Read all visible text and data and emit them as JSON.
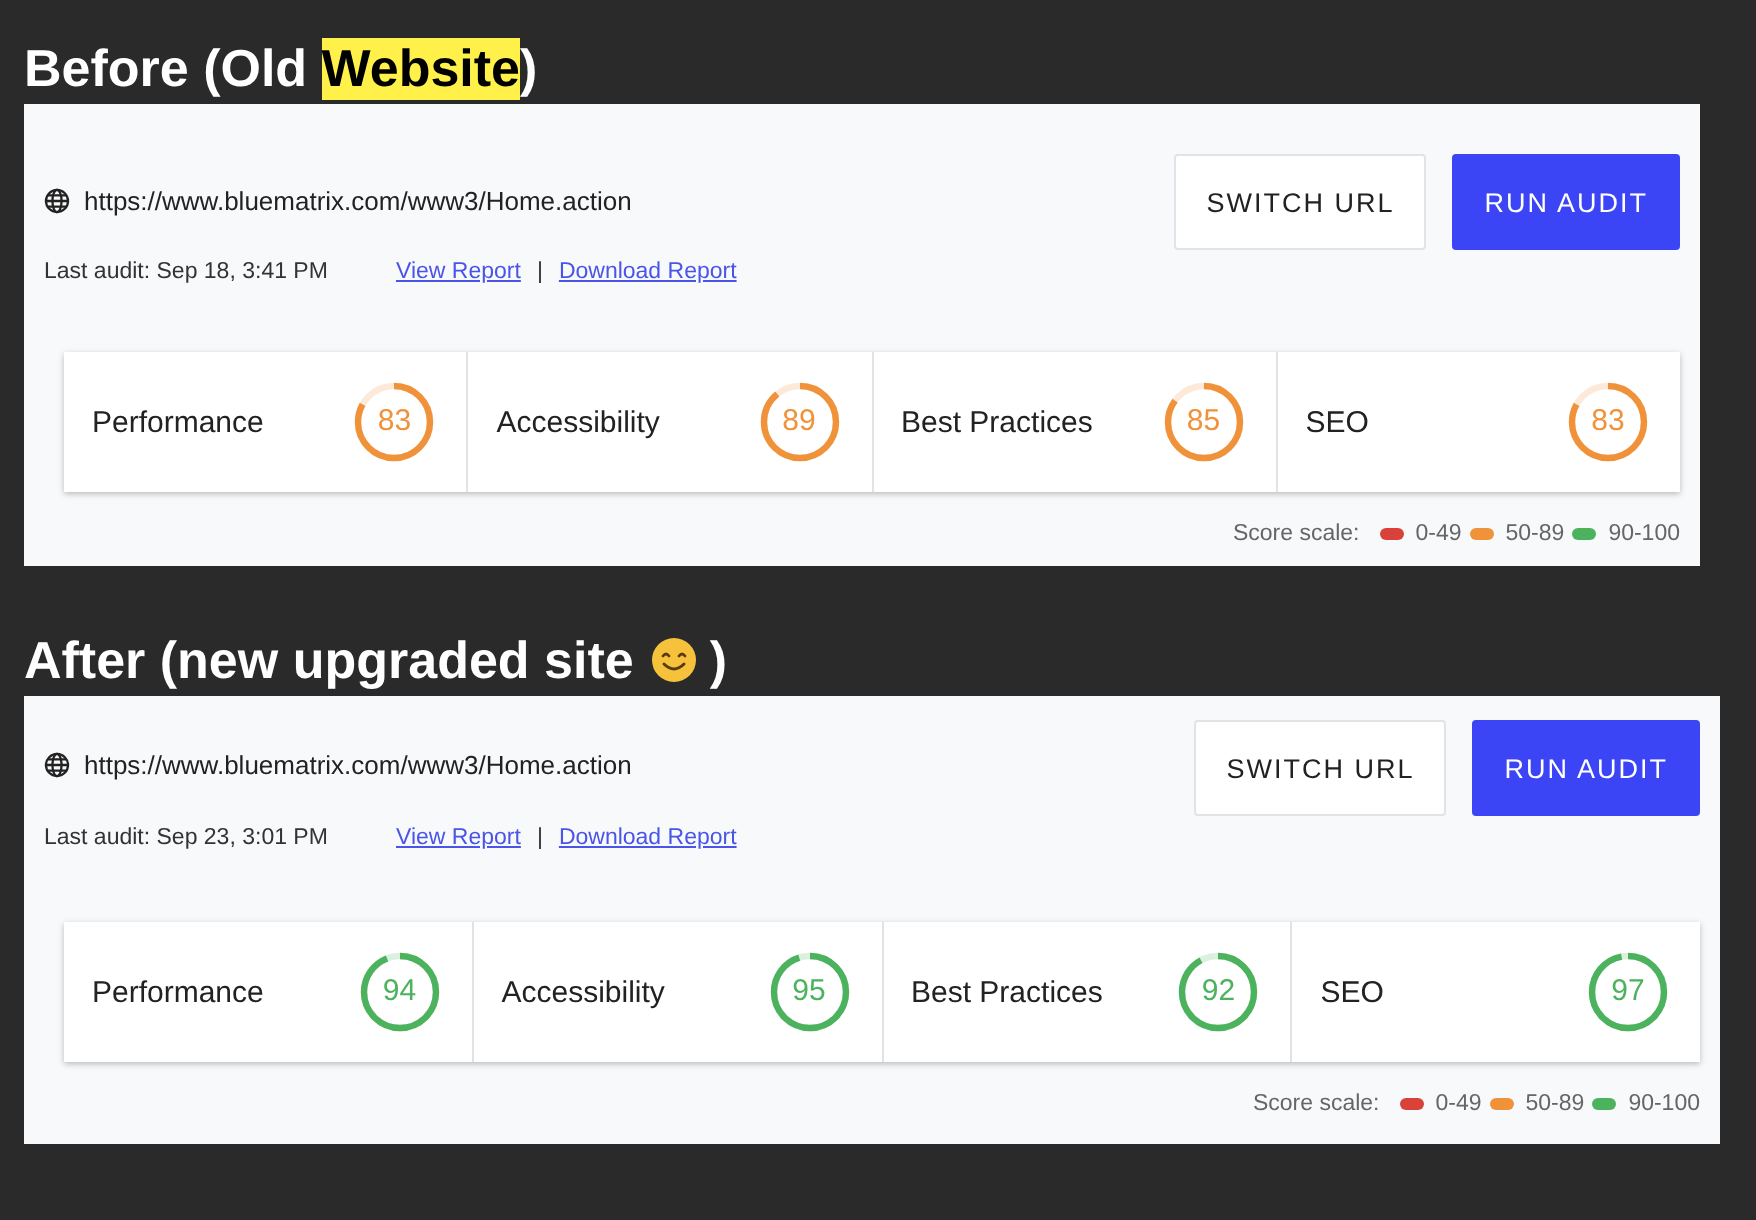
{
  "sections": [
    {
      "heading": [
        {
          "kind": "text",
          "text": "Before (Old "
        },
        {
          "kind": "highlight",
          "text": "Website"
        },
        {
          "kind": "text",
          "text": ")"
        }
      ],
      "url": "https://www.bluematrix.com/www3/Home.action",
      "last_audit": "Last audit: Sep 18, 3:41 PM",
      "links": [
        "View Report",
        "Download Report"
      ],
      "separator": "|",
      "buttons": [
        {
          "label": "SWITCH URL",
          "kind": "secondary"
        },
        {
          "label": "RUN AUDIT",
          "kind": "primary"
        }
      ],
      "scores": [
        {
          "label": "Performance",
          "score": "83",
          "color": "#f0923a"
        },
        {
          "label": "Accessibility",
          "score": "89",
          "color": "#f0923a"
        },
        {
          "label": "Best Practices",
          "score": "85",
          "color": "#f0923a"
        },
        {
          "label": "SEO",
          "score": "83",
          "color": "#f0923a"
        }
      ],
      "legend": {
        "title": "Score scale:",
        "items": [
          {
            "label": "0-49",
            "color": "#d9423a"
          },
          {
            "label": "50-89",
            "color": "#f0923a"
          },
          {
            "label": "90-100",
            "color": "#4cb25e"
          }
        ]
      }
    },
    {
      "heading": [
        {
          "kind": "text",
          "text": "After (new upgraded site"
        },
        {
          "kind": "smiley"
        },
        {
          "kind": "text",
          "text": ")"
        }
      ],
      "url": "https://www.bluematrix.com/www3/Home.action",
      "last_audit": "Last audit: Sep 23, 3:01 PM",
      "links": [
        "View Report",
        "Download Report"
      ],
      "separator": "|",
      "buttons": [
        {
          "label": "SWITCH URL",
          "kind": "secondary"
        },
        {
          "label": "RUN AUDIT",
          "kind": "primary"
        }
      ],
      "scores": [
        {
          "label": "Performance",
          "score": "94",
          "color": "#4cb25e"
        },
        {
          "label": "Accessibility",
          "score": "95",
          "color": "#4cb25e"
        },
        {
          "label": "Best Practices",
          "score": "92",
          "color": "#4cb25e"
        },
        {
          "label": "SEO",
          "score": "97",
          "color": "#4cb25e"
        }
      ],
      "legend": {
        "title": "Score scale:",
        "items": [
          {
            "label": "0-49",
            "color": "#d9423a"
          },
          {
            "label": "50-89",
            "color": "#f0923a"
          },
          {
            "label": "90-100",
            "color": "#4cb25e"
          }
        ]
      }
    }
  ]
}
